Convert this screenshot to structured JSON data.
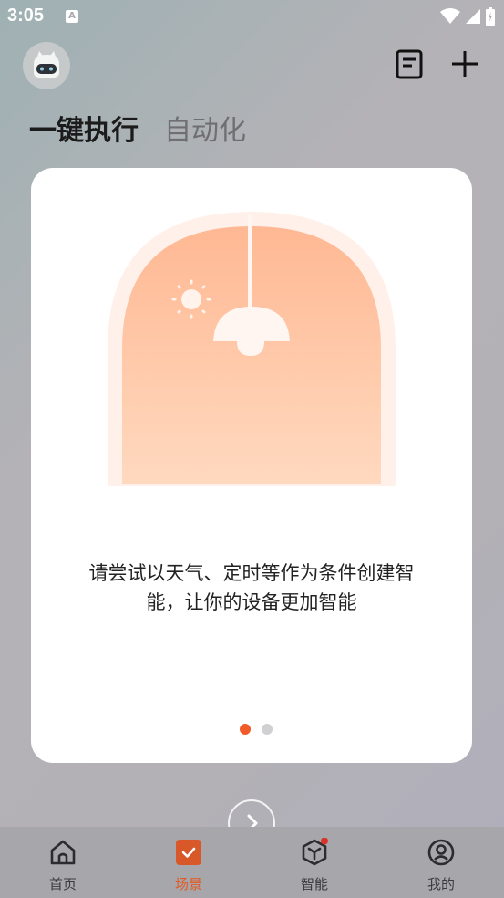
{
  "status_bar": {
    "time": "3:05",
    "notif_letter": "A"
  },
  "header": {
    "avatar_icon": "robot-avatar-icon",
    "doc_icon": "document-icon",
    "add_icon": "plus-icon"
  },
  "tabs": [
    {
      "label": "一键执行",
      "active": true
    },
    {
      "label": "自动化",
      "active": false
    }
  ],
  "card": {
    "line1": "请尝试以天气、定时等作为条件创建智",
    "line2": "能，让你的设备更加智能",
    "page_count": 2,
    "active_page": 1
  },
  "nav": [
    {
      "label": "首页",
      "icon": "home-icon"
    },
    {
      "label": "场景",
      "icon": "scene-check-icon",
      "active": true
    },
    {
      "label": "智能",
      "icon": "cube-icon",
      "badge": true
    },
    {
      "label": "我的",
      "icon": "profile-icon"
    }
  ],
  "colors": {
    "accent": "#f15b2a",
    "peach": "#ffb893"
  }
}
